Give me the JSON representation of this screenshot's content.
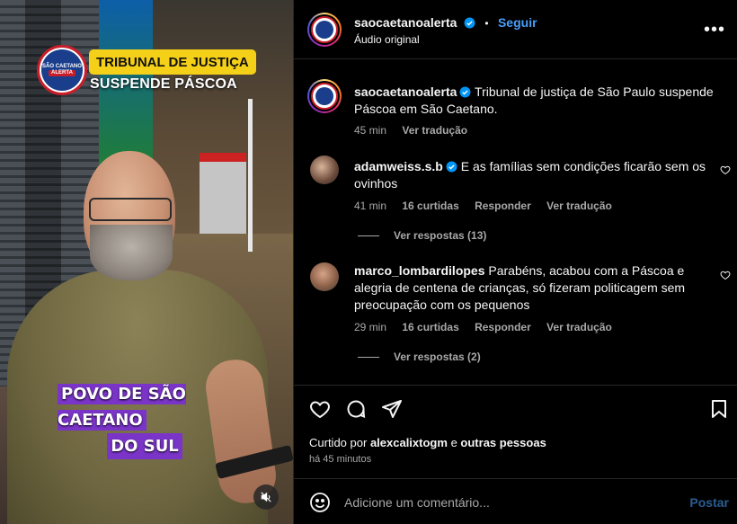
{
  "video": {
    "banner_title": "TRIBUNAL DE JUSTIÇA",
    "banner_subtitle": "SUSPENDE PÁSCOA",
    "logo_text_top": "SÃO CAETANO",
    "logo_text_bottom": "ALERTA",
    "caption_line1": "POVO DE SÃO CAETANO",
    "caption_line2": "DO SUL",
    "mute_icon": "speaker-muted-icon"
  },
  "header": {
    "username": "saocaetanoalerta",
    "separator": "•",
    "follow_label": "Seguir",
    "audio_label": "Áudio original",
    "more_icon": "more-options-icon"
  },
  "caption": {
    "username": "saocaetanoalerta",
    "text": "Tribunal de justiça de São Paulo suspende Páscoa em São Caetano.",
    "time": "45 min",
    "translate": "Ver tradução"
  },
  "comments": [
    {
      "username": "adamweiss.s.b",
      "verified": true,
      "text": "E as famílias sem condições ficarão sem os ovinhos",
      "time": "41 min",
      "likes": "16 curtidas",
      "reply": "Responder",
      "translate": "Ver tradução",
      "view_replies": "Ver respostas (13)"
    },
    {
      "username": "marco_lombardilopes",
      "verified": false,
      "text": "Parabéns, acabou com a Páscoa e alegria de centena de crianças, só fizeram politicagem sem preocupação com os pequenos",
      "time": "29 min",
      "likes": "16 curtidas",
      "reply": "Responder",
      "translate": "Ver tradução",
      "view_replies": "Ver respostas (2)"
    }
  ],
  "actions": {
    "liked_by_prefix": "Curtido por",
    "liked_by_user": "alexcalixtogm",
    "liked_by_and": "e",
    "liked_by_others": "outras pessoas",
    "time_ago": "há 45 minutos"
  },
  "add_comment": {
    "placeholder": "Adicione um comentário...",
    "post_label": "Postar"
  },
  "colors": {
    "accent_blue": "#4a9df8",
    "post_disabled": "#2a5d93",
    "banner_yellow": "#f5d018",
    "caption_purple": "#7a34c8",
    "brand_red": "#c81e2b"
  }
}
